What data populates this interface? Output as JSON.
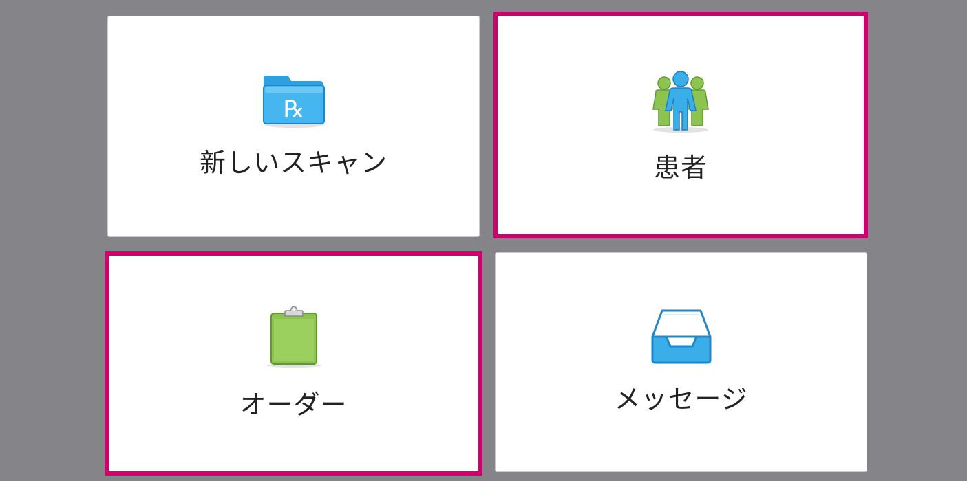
{
  "tiles": {
    "new_scan": {
      "label": "新しいスキャン",
      "icon": "rx-folder-icon",
      "highlighted": false
    },
    "patients": {
      "label": "患者",
      "icon": "patients-icon",
      "highlighted": true
    },
    "orders": {
      "label": "オーダー",
      "icon": "clipboard-icon",
      "highlighted": true
    },
    "messages": {
      "label": "メッセージ",
      "icon": "inbox-tray-icon",
      "highlighted": false
    },
    "rx_symbol": "℞"
  },
  "colors": {
    "background": "#858589",
    "tile": "#ffffff",
    "highlight_border": "#d1006e",
    "icon_blue": "#3aaee8",
    "icon_green": "#8cc44f"
  }
}
